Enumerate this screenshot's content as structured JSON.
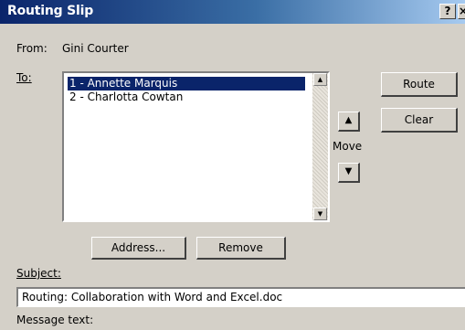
{
  "window": {
    "title": "Routing Slip",
    "help_label": "?",
    "close_label": "×"
  },
  "from": {
    "label": "From:",
    "value": "Gini Courter"
  },
  "to": {
    "label": "To:",
    "recipients": [
      "1 - Annette Marquis",
      "2 - Charlotta Cowtan"
    ],
    "selected_index": 0
  },
  "buttons": {
    "route": "Route",
    "clear": "Clear",
    "move_label": "Move",
    "move_up": "▲",
    "move_down": "▼",
    "address": "Address...",
    "remove": "Remove"
  },
  "subject": {
    "label": "Subject:",
    "value": "Routing: Collaboration with Word and Excel.doc"
  },
  "message": {
    "label": "Message text:"
  },
  "colors": {
    "titlebar": "#0a246a",
    "dialog_bg": "#d4d0c8",
    "selection": "#0a246a"
  }
}
